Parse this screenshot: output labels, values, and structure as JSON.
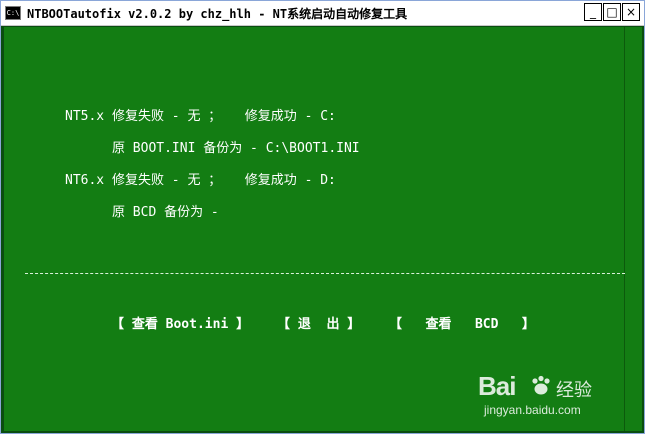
{
  "window": {
    "title": "NTBOOTautofix v2.0.2 by chz_hlh - NT系统启动自动修复工具",
    "icon_text": "C:\\",
    "minimize_glyph": "_",
    "maximize_glyph": "□",
    "close_glyph": "×"
  },
  "console": {
    "lines": [
      "NT5.x 修复失败 - 无 ；   修复成功 - C:",
      "      原 BOOT.INI 备份为 - C:\\BOOT1.INI",
      "NT6.x 修复失败 - 无 ；   修复成功 - D:",
      "      原 BCD 备份为 -"
    ]
  },
  "menu": {
    "view_boot_ini": "【 查看 Boot.ini 】",
    "exit": "【 退  出 】",
    "view_bcd": "【   查看   BCD   】"
  },
  "watermark": {
    "logo": "Bai",
    "logo_cn": "经验",
    "url": "jingyan.baidu.com"
  }
}
